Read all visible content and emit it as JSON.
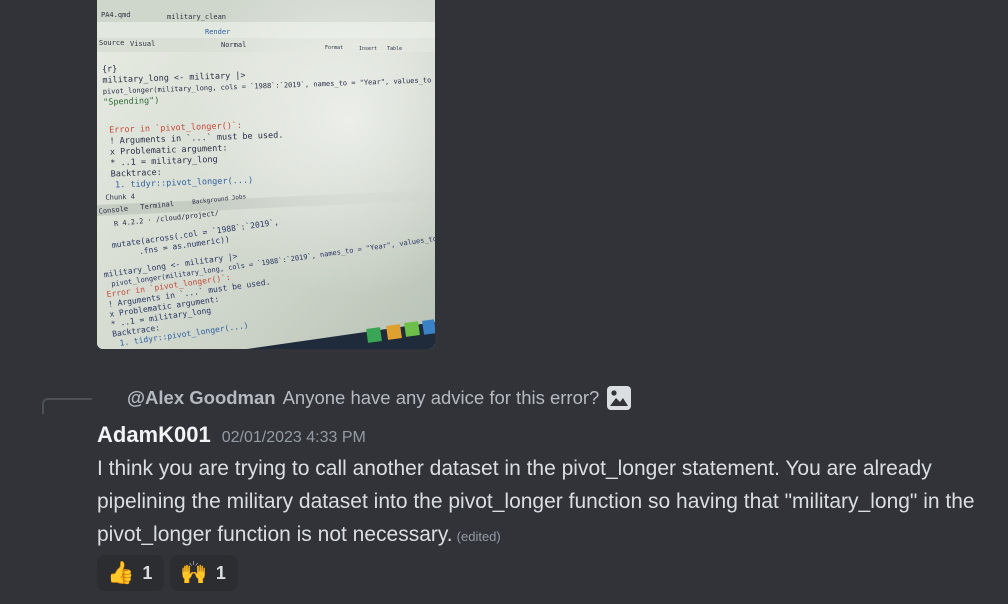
{
  "attachment": {
    "alt": "photo",
    "code_lines": {
      "tabs": [
        "PA4.qmd",
        "military_clean"
      ],
      "toolbar": [
        "Render",
        "Source",
        "Visual",
        "Normal",
        "Format",
        "Insert",
        "Table"
      ],
      "editor": [
        "{r}",
        "military_long <- military |>",
        "  pivot_longer(military_long, cols = `1988`:`2019`, names_to = \"Year\", values_to =",
        "\"Spending\")",
        "",
        "Error in `pivot_longer()`:",
        "! Arguments in `...` must be used.",
        "x Problematic argument:",
        "* ..1 = military_long",
        "Backtrace:",
        "  1. tidyr::pivot_longer(...)"
      ],
      "chunk_label": "Chunk 4",
      "console_tabs": [
        "Console",
        "Terminal",
        "Background Jobs"
      ],
      "console_path": "R 4.2.2 · /cloud/project/",
      "console": [
        "  mutate(across(.col = `1988`:`2019`,",
        "         .fns = as.numeric))",
        "military_long <- military |>",
        "  pivot_longer(military_long, cols = `1988`:`2019`, names_to = \"Year\", values_to =",
        "Error in `pivot_longer()`:",
        "! Arguments in `...` must be used.",
        "x Problematic argument:",
        "* ..1 = military_long",
        "Backtrace:",
        "  1. tidyr::pivot_longer(...)"
      ]
    }
  },
  "reply": {
    "author": "@Alex Goodman",
    "text": "Anyone have any advice for this error?",
    "icon": "image-icon"
  },
  "message": {
    "author": "AdamK001",
    "timestamp": "02/01/2023 4:33 PM",
    "text": "I think you are trying to call another dataset in the pivot_longer statement. You are already pipelining the military dataset into the pivot_longer function so having that \"military_long\" in the pivot_longer function is not necessary.",
    "edited": "(edited)"
  },
  "reactions": [
    {
      "emoji": "👍",
      "count": "1",
      "name": "thumbs-up"
    },
    {
      "emoji": "🙌",
      "count": "1",
      "name": "raised-hands"
    }
  ],
  "colors": {
    "background": "#313338",
    "author": "#f2f3f5",
    "timestamp": "#949ba4",
    "body_text": "#dbdee1",
    "reaction_bg": "#2b2d31"
  }
}
